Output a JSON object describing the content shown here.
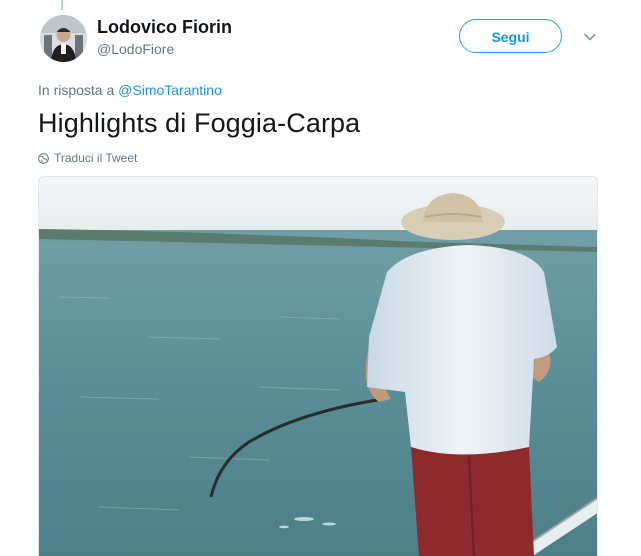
{
  "user": {
    "name": "Lodovico Fiorin",
    "handle": "@LodoFiore",
    "avatar_icon": "profile-photo"
  },
  "follow_button": {
    "label": "Segui"
  },
  "menu_icon": "chevron-down-icon",
  "reply": {
    "prefix": "In risposta a",
    "mention": "@SimoTarantino"
  },
  "tweet": {
    "text": "Highlights di Foggia-Carpa"
  },
  "translate": {
    "label": "Traduci il Tweet",
    "icon": "globe-icon"
  },
  "colors": {
    "accent": "#1da1f2",
    "link": "#1b95e0",
    "muted": "#657786",
    "text": "#14171a",
    "thread_line": "#a3d9f0"
  },
  "media": {
    "type": "gif-preview",
    "icon": "media-image"
  }
}
